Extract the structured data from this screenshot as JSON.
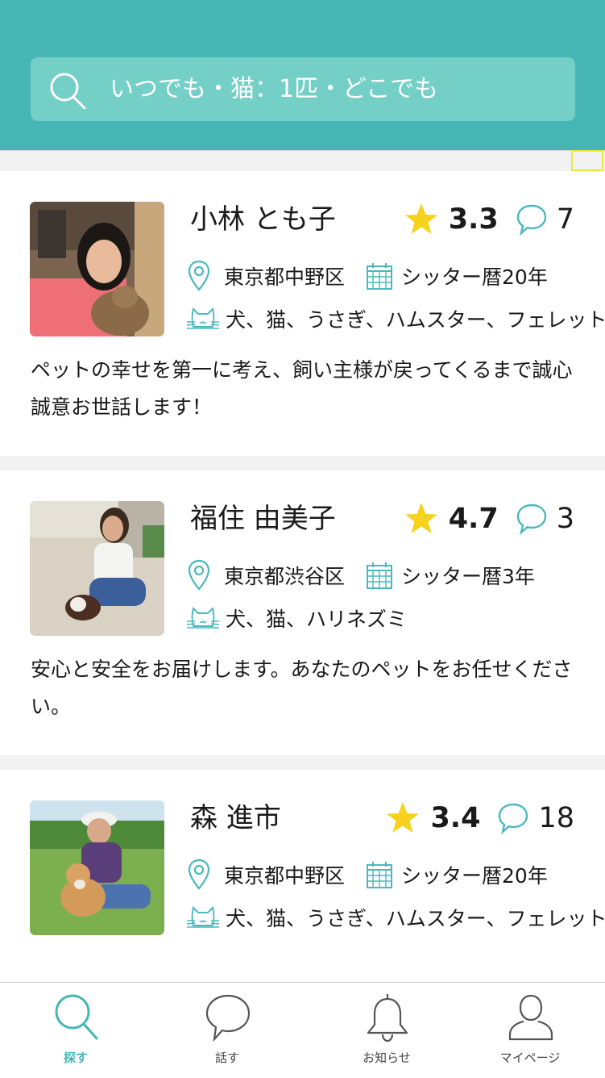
{
  "search": {
    "text": "いつでも・猫：1匹・どこでも"
  },
  "sitters": [
    {
      "name": "小林 とも子",
      "rating": "3.3",
      "reviews": "7",
      "location": "東京都中野区",
      "experience": "シッター暦20年",
      "pets": "犬、猫、うさぎ、ハムスター、フェレット",
      "description": "ペットの幸せを第一に考え、飼い主様が戻ってくるまで誠心誠意お世話します！"
    },
    {
      "name": "福住 由美子",
      "rating": "4.7",
      "reviews": "3",
      "location": "東京都渋谷区",
      "experience": "シッター暦3年",
      "pets": "犬、猫、ハリネズミ",
      "description": "安心と安全をお届けします。あなたのペットをお任せください。"
    },
    {
      "name": "森 進市",
      "rating": "3.4",
      "reviews": "18",
      "location": "東京都中野区",
      "experience": "シッター暦20年",
      "pets": "犬、猫、うさぎ、ハムスター、フェレット",
      "description": ""
    }
  ],
  "tabs": [
    {
      "label": "探す",
      "icon": "search-icon",
      "active": true
    },
    {
      "label": "話す",
      "icon": "chat-icon",
      "active": false
    },
    {
      "label": "お知らせ",
      "icon": "bell-icon",
      "active": false
    },
    {
      "label": "マイページ",
      "icon": "person-icon",
      "active": false
    }
  ],
  "colors": {
    "accent": "#46b6b5",
    "search_bg": "#74cfc6",
    "star": "#f6d21c",
    "icon_teal": "#4bb8bf"
  }
}
